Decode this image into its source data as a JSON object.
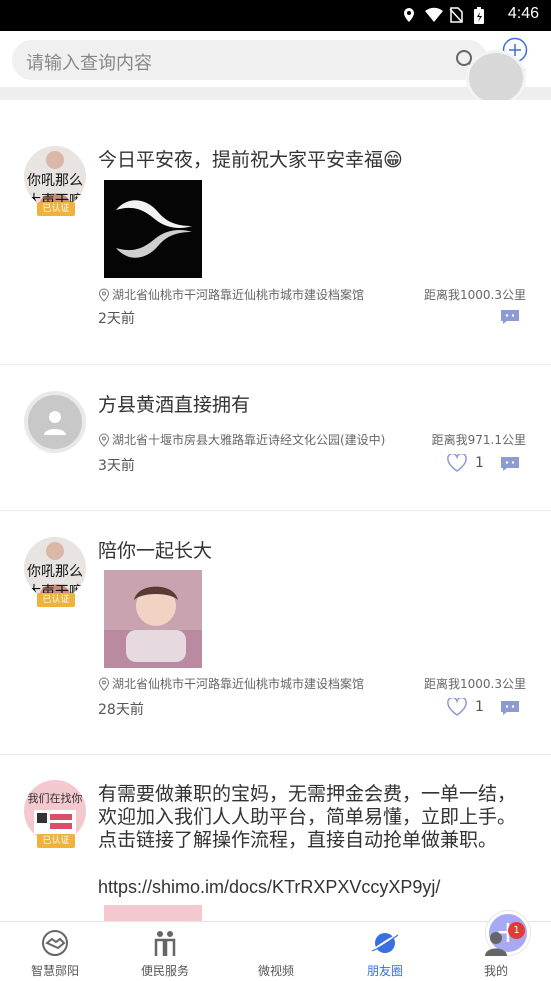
{
  "status_bar": {
    "time": "4:46"
  },
  "search": {
    "placeholder": "请输入查询内容"
  },
  "publish": {
    "label": "发布"
  },
  "posts": [
    {
      "avatar_text": "你吼那么\n大声干嘛",
      "badge": "已认证",
      "title": "今日平安夜，提前祝大家平安幸福😁",
      "location": "湖北省仙桃市干河路靠近仙桃市城市建设档案馆",
      "distance": "距离我1000.3公里",
      "time": "2天前"
    },
    {
      "title": "方县黄酒直接拥有",
      "location": "湖北省十堰市房县大雅路靠近诗经文化公园(建设中)",
      "distance": "距离我971.1公里",
      "time": "3天前",
      "likes": "1"
    },
    {
      "avatar_text": "你吼那么\n大声干嘛",
      "badge": "已认证",
      "title": "陪你一起长大",
      "location": "湖北省仙桃市干河路靠近仙桃市城市建设档案馆",
      "distance": "距离我1000.3公里",
      "time": "28天前",
      "likes": "1"
    },
    {
      "avatar_text": "我们在找你",
      "badge": "已认证",
      "text": "有需要做兼职的宝妈，无需押金会费，一单一结，欢迎加入我们人人助平台，简单易懂，立即上手。点击链接了解操作流程，直接自动抢单做兼职。",
      "link": "https://shimo.im/docs/KTrRXPXVccyXP9yj/"
    }
  ],
  "tabs": [
    {
      "label": "智慧郧阳",
      "icon": "handshake-icon"
    },
    {
      "label": "便民服务",
      "icon": "people-icon"
    },
    {
      "label": "微视频",
      "icon": "plus-icon"
    },
    {
      "label": "朋友圈",
      "icon": "planet-icon"
    },
    {
      "label": "我的",
      "icon": "user-icon"
    }
  ],
  "notification_count": "1",
  "colors": {
    "accent": "#3a6fe0",
    "badge": "#f0b23b",
    "fab": "#a7a9f2",
    "notif": "#e53935"
  }
}
